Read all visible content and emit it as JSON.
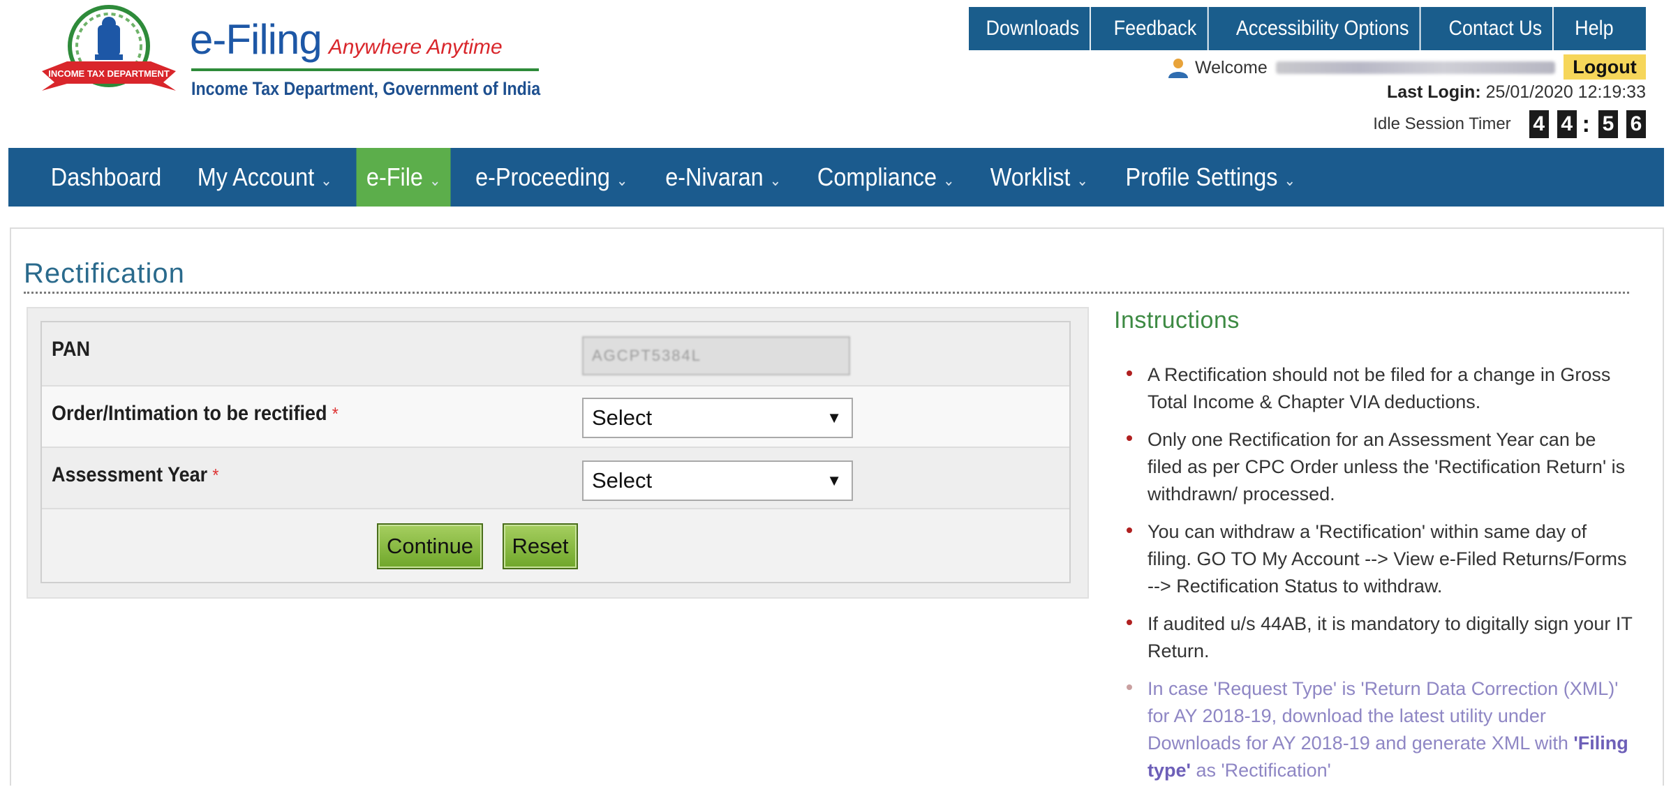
{
  "brand": {
    "title": "e-Filing",
    "tagline": "Anywhere Anytime",
    "subtitle": "Income Tax Department, Government of India",
    "logo_icon": "emblem-logo-icon"
  },
  "top_nav": [
    "Downloads",
    "Feedback",
    "Accessibility Options",
    "Contact Us",
    "Help"
  ],
  "user": {
    "welcome_label": "Welcome",
    "logout_label": "Logout",
    "last_login_label": "Last Login:",
    "last_login_value": "25/01/2020 12:19:33",
    "idle_timer_label": "Idle Session Timer",
    "timer_digits": [
      "4",
      "4",
      "5",
      "6"
    ]
  },
  "main_nav": [
    {
      "label": "Dashboard",
      "has_dropdown": false
    },
    {
      "label": "My Account",
      "has_dropdown": true
    },
    {
      "label": "e-File",
      "has_dropdown": true,
      "active": true
    },
    {
      "label": "e-Proceeding",
      "has_dropdown": true
    },
    {
      "label": "e-Nivaran",
      "has_dropdown": true
    },
    {
      "label": "Compliance",
      "has_dropdown": true
    },
    {
      "label": "Worklist",
      "has_dropdown": true
    },
    {
      "label": "Profile Settings",
      "has_dropdown": true
    }
  ],
  "page": {
    "title": "Rectification"
  },
  "form": {
    "pan_label": "PAN",
    "pan_value": "AGCPT5384L",
    "order_label": "Order/Intimation to be rectified",
    "order_selected": "Select",
    "ay_label": "Assessment Year",
    "ay_selected": "Select",
    "required_mark": "*",
    "continue_label": "Continue",
    "reset_label": "Reset"
  },
  "instructions": {
    "title": "Instructions",
    "items": [
      "A Rectification should not be filed for a change in Gross Total Income & Chapter VIA deductions.",
      "Only one Rectification for an Assessment Year can be filed as per CPC Order unless the 'Rectification Return' is withdrawn/ processed.",
      "You can withdraw a 'Rectification' within same day of filing. GO TO My Account --> View e-Filed Returns/Forms --> Rectification Status to withdraw.",
      "If audited u/s 44AB, it is mandatory to digitally sign your IT Return."
    ],
    "last_item": {
      "before": "In case 'Request Type' is 'Return Data Correction (XML)' for AY 2018-19, download the latest utility under Downloads for AY 2018-19 and generate XML with ",
      "emphasis": "'Filing type'",
      "after": " as 'Rectification'"
    }
  },
  "colors": {
    "nav_blue": "#1b5b8e",
    "active_green": "#5cae4b",
    "logout_yellow": "#f6d65a",
    "brand_blue": "#1d57a6",
    "tag_red": "#d9262b",
    "button_green": "#8abd45"
  }
}
